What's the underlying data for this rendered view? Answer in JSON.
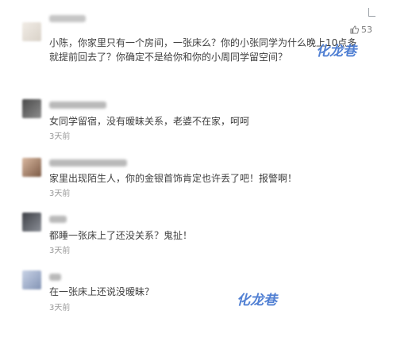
{
  "comments": [
    {
      "text": "小陈，你家里只有一个房间，一张床么？你的小张同学为什么晚上10点多就提前回去了？你确定不是给你和你的小周同学留空间？",
      "likes": "53"
    },
    {
      "text": "女同学留宿，没有暧昧关系，老婆不在家，呵呵",
      "time": "3天前"
    },
    {
      "text": "家里出现陌生人，你的金银首饰肯定也许丢了吧！报警啊！",
      "time": "3天前"
    },
    {
      "text": "都睡一张床上了还没关系？鬼扯！",
      "time": "3天前"
    },
    {
      "text": "在一张床上还说没暧昧？",
      "time": "3天前"
    }
  ],
  "watermark": {
    "text": "化龙巷"
  },
  "icons": {
    "like": "thumbs-up-icon"
  },
  "colors": {
    "accent": "#3f73cf",
    "muted": "#9a9a9a",
    "text": "#404040"
  }
}
